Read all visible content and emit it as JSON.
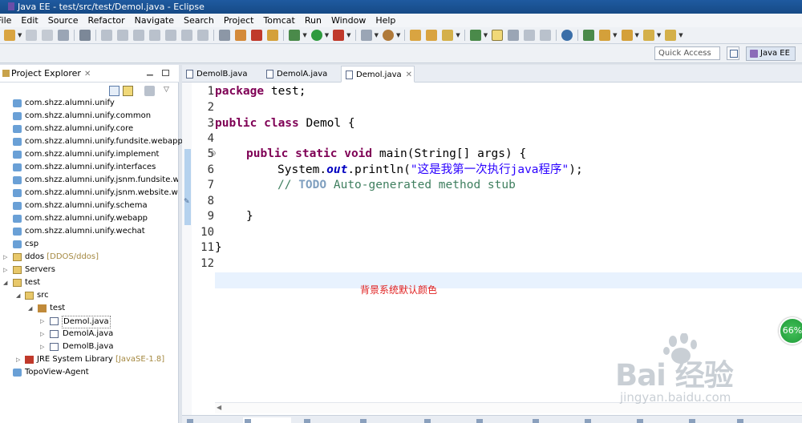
{
  "window": {
    "title": "Java EE - test/src/test/Demol.java - Eclipse"
  },
  "menu": [
    "File",
    "Edit",
    "Source",
    "Refactor",
    "Navigate",
    "Search",
    "Project",
    "Tomcat",
    "Run",
    "Window",
    "Help"
  ],
  "quick_access": {
    "placeholder": "Quick Access"
  },
  "perspective": {
    "label": "Java EE"
  },
  "project_explorer": {
    "tab_label": "Project Explorer",
    "tree": [
      {
        "label": "com.shzz.alumni.unify",
        "icon": "package-icon"
      },
      {
        "label": "com.shzz.alumni.unify.common",
        "icon": "package-icon"
      },
      {
        "label": "com.shzz.alumni.unify.core",
        "icon": "package-icon"
      },
      {
        "label": "com.shzz.alumni.unify.fundsite.webapp",
        "icon": "package-icon"
      },
      {
        "label": "com.shzz.alumni.unify.implement",
        "icon": "package-icon"
      },
      {
        "label": "com.shzz.alumni.unify.interfaces",
        "icon": "package-icon"
      },
      {
        "label": "com.shzz.alumni.unify.jsnm.fundsite.webapp",
        "icon": "package-icon"
      },
      {
        "label": "com.shzz.alumni.unify.jsnm.website.webapp",
        "icon": "package-icon"
      },
      {
        "label": "com.shzz.alumni.unify.schema",
        "icon": "package-icon"
      },
      {
        "label": "com.shzz.alumni.unify.webapp",
        "icon": "package-icon"
      },
      {
        "label": "com.shzz.alumni.unify.wechat",
        "icon": "package-icon"
      },
      {
        "label": "csp",
        "icon": "package-icon"
      },
      {
        "label": "ddos",
        "decoration": "[DDOS/ddos]",
        "icon": "project-icon"
      },
      {
        "label": "Servers",
        "icon": "folder-icon"
      },
      {
        "label": "test",
        "icon": "project-icon"
      },
      {
        "label": "src",
        "icon": "source-folder-icon"
      },
      {
        "label": "test",
        "icon": "java-package-icon"
      },
      {
        "label": "Demol.java",
        "icon": "java-file-icon"
      },
      {
        "label": "DemolA.java",
        "icon": "java-file-icon"
      },
      {
        "label": "DemolB.java",
        "icon": "java-file-icon"
      },
      {
        "label": "JRE System Library",
        "decoration": "[JavaSE-1.8]",
        "icon": "library-icon"
      },
      {
        "label": "TopoView-Agent",
        "icon": "package-icon"
      }
    ]
  },
  "editor": {
    "tabs": [
      {
        "label": "DemolB.java"
      },
      {
        "label": "DemolA.java"
      },
      {
        "label": "Demol.java",
        "active": true
      }
    ],
    "line_numbers": [
      "1",
      "2",
      "3",
      "4",
      "5",
      "6",
      "7",
      "8",
      "9",
      "10",
      "11",
      "12"
    ],
    "code": {
      "l1_kw": "package",
      "l1_rest": " test;",
      "l3_kw": "public class",
      "l3_rest": " Demol {",
      "l5_kw": "public static void",
      "l5_rest": " main(String[] args) {",
      "l6_pre": "System.",
      "l6_field": "out",
      "l6_mid": ".println(",
      "l6_str": "\"这是我第一次执行java程序\"",
      "l6_post": ");",
      "l7_pre": "// ",
      "l7_todo": "TODO",
      "l7_rest": " Auto-generated method stub",
      "l9": "}",
      "l11": "}"
    },
    "annotation": "背景系统默认颜色"
  },
  "progress_badge": "66%",
  "watermark": {
    "brand": "Bai 经验",
    "url": "jingyan.baidu.com"
  }
}
